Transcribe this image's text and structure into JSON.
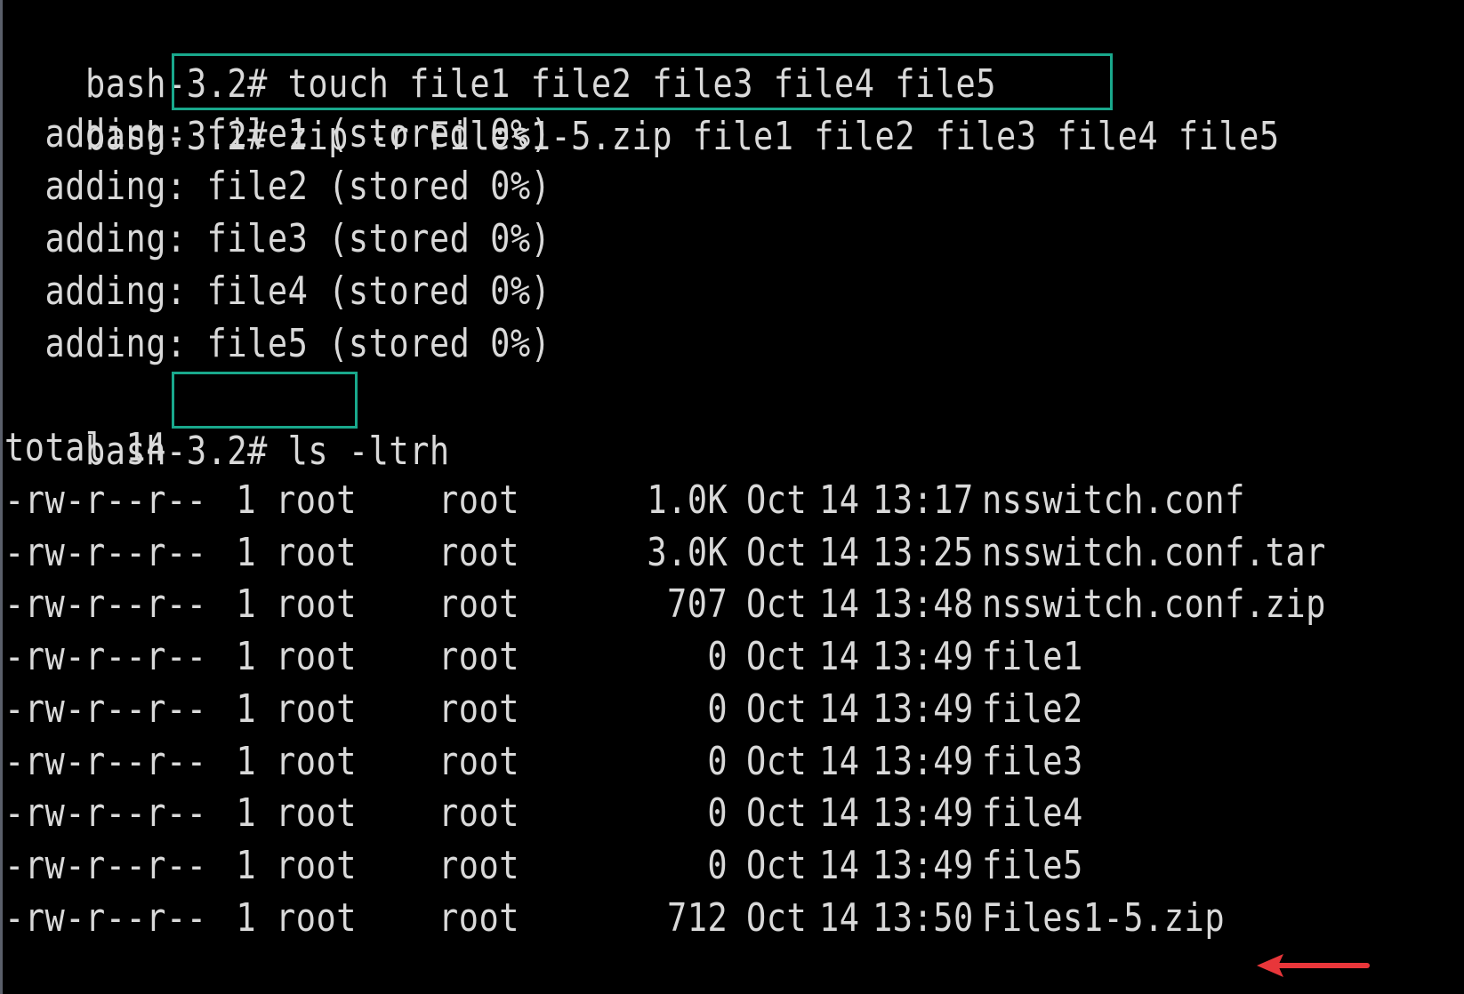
{
  "terminal": {
    "prompt": "bash-3.2#",
    "commands": [
      {
        "text": " touch file1 file2 file3 file4 file5",
        "highlighted": false
      },
      {
        "text": " zip -r Files1-5.zip file1 file2 file3 file4 file5",
        "highlighted": true
      },
      {
        "text": " ls -ltrh",
        "highlighted": true
      }
    ],
    "zip_output": [
      "  adding: file1 (stored 0%)",
      "  adding: file2 (stored 0%)",
      "  adding: file3 (stored 0%)",
      "  adding: file4 (stored 0%)",
      "  adding: file5 (stored 0%)"
    ],
    "total": "total 14",
    "listing": [
      {
        "perms": "-rw-r--r--",
        "links": "1",
        "owner": "root",
        "group": "root",
        "size": "1.0K",
        "month": "Oct",
        "day": "14",
        "time": "13:17",
        "name": "nsswitch.conf"
      },
      {
        "perms": "-rw-r--r--",
        "links": "1",
        "owner": "root",
        "group": "root",
        "size": "3.0K",
        "month": "Oct",
        "day": "14",
        "time": "13:25",
        "name": "nsswitch.conf.tar"
      },
      {
        "perms": "-rw-r--r--",
        "links": "1",
        "owner": "root",
        "group": "root",
        "size": "707",
        "month": "Oct",
        "day": "14",
        "time": "13:48",
        "name": "nsswitch.conf.zip"
      },
      {
        "perms": "-rw-r--r--",
        "links": "1",
        "owner": "root",
        "group": "root",
        "size": "0",
        "month": "Oct",
        "day": "14",
        "time": "13:49",
        "name": "file1"
      },
      {
        "perms": "-rw-r--r--",
        "links": "1",
        "owner": "root",
        "group": "root",
        "size": "0",
        "month": "Oct",
        "day": "14",
        "time": "13:49",
        "name": "file2"
      },
      {
        "perms": "-rw-r--r--",
        "links": "1",
        "owner": "root",
        "group": "root",
        "size": "0",
        "month": "Oct",
        "day": "14",
        "time": "13:49",
        "name": "file3"
      },
      {
        "perms": "-rw-r--r--",
        "links": "1",
        "owner": "root",
        "group": "root",
        "size": "0",
        "month": "Oct",
        "day": "14",
        "time": "13:49",
        "name": "file4"
      },
      {
        "perms": "-rw-r--r--",
        "links": "1",
        "owner": "root",
        "group": "root",
        "size": "0",
        "month": "Oct",
        "day": "14",
        "time": "13:49",
        "name": "file5"
      },
      {
        "perms": "-rw-r--r--",
        "links": "1",
        "owner": "root",
        "group": "root",
        "size": "712",
        "month": "Oct",
        "day": "14",
        "time": "13:50",
        "name": "Files1-5.zip"
      }
    ]
  },
  "colors": {
    "background": "#000000",
    "text": "#d9d9d9",
    "highlight_box": "#19a88c",
    "arrow": "#e8363a"
  },
  "icons": {
    "annotation_arrow": "left-arrow-icon"
  }
}
